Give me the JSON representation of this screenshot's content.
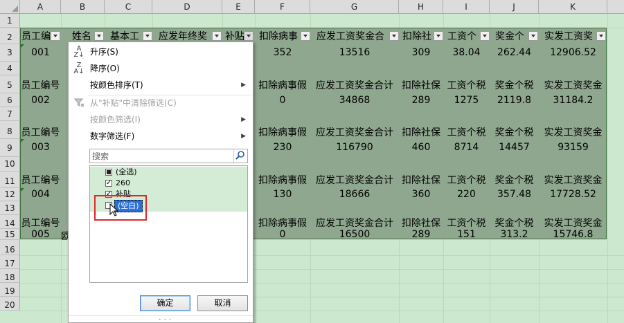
{
  "columns": [
    "A",
    "B",
    "C",
    "D",
    "E",
    "F",
    "G",
    "H",
    "I",
    "J",
    "K"
  ],
  "rows": [
    "1",
    "2",
    "3",
    "4",
    "5",
    "6",
    "7",
    "8",
    "9",
    "10",
    "11",
    "12",
    "13",
    "14",
    "15",
    "16",
    "17",
    "18",
    "19",
    "20"
  ],
  "header_row": {
    "A": "员工编",
    "B": "姓名",
    "C": "基本工",
    "D": "应发年终奖",
    "E": "补贴",
    "F": "扣除病事",
    "G": "应发工资奖金合",
    "H": "扣除社",
    "I": "工资个",
    "J": "奖金个",
    "K": "实发工资奖"
  },
  "repeat_header": {
    "A": "员工编号",
    "F": "扣除病事假",
    "G": "应发工资奖金合计",
    "H": "扣除社保",
    "I": "工资个税",
    "J": "奖金个税",
    "K": "实发工资奖金"
  },
  "records": [
    {
      "row": "3",
      "A": "001",
      "F": "352",
      "G": "13516",
      "H": "309",
      "I": "38.04",
      "J": "262.44",
      "K": "12906.52"
    },
    {
      "row": "6",
      "A": "002",
      "F": "0",
      "G": "34868",
      "H": "289",
      "I": "1275",
      "J": "2119.8",
      "K": "31184.2"
    },
    {
      "row": "9",
      "A": "003",
      "F": "230",
      "G": "116790",
      "H": "460",
      "I": "8714",
      "J": "14457",
      "K": "93159"
    },
    {
      "row": "12",
      "A": "004",
      "F": "130",
      "G": "18666",
      "H": "360",
      "I": "220",
      "J": "357.48",
      "K": "17728.52"
    },
    {
      "row": "15",
      "A": "005",
      "B": "欧",
      "F": "0",
      "G": "16500",
      "H": "289",
      "I": "151",
      "J": "313.2",
      "K": "15746.8"
    }
  ],
  "filter_menu": {
    "sort_asc": "升序(S)",
    "sort_desc": "降序(O)",
    "sort_by_color": "按颜色排序(T)",
    "clear_filter": "从\"补贴\"中清除筛选(C)",
    "filter_by_color": "按颜色筛选(I)",
    "number_filter": "数字筛选(F)",
    "search_placeholder": "搜索",
    "list": [
      {
        "label": "(全选)",
        "state": "partial"
      },
      {
        "label": "260",
        "state": "checked"
      },
      {
        "label": "补贴",
        "state": "checked"
      },
      {
        "label": "(空白)",
        "state": "unchecked"
      }
    ],
    "ok": "确定",
    "cancel": "取消"
  },
  "colors": {
    "sheet_bg": "#cce8cf",
    "table_fill": "#8fa78f",
    "highlight_box": "#e0262b",
    "selection": "#2a6fd6"
  }
}
